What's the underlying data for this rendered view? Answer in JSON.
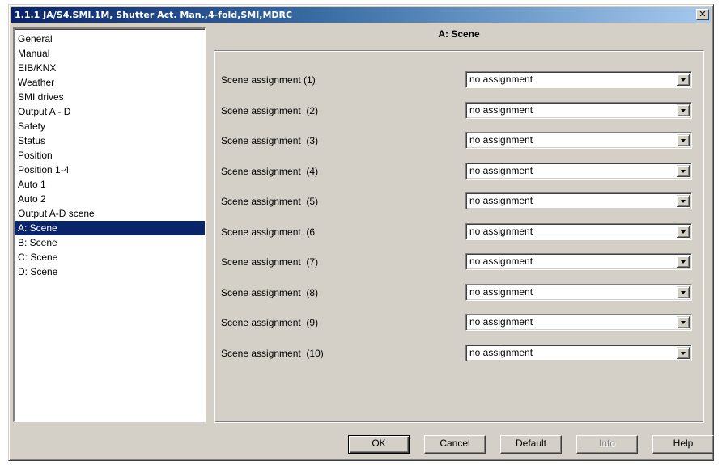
{
  "window": {
    "title": "1.1.1 JA/S4.SMI.1M, Shutter Act. Man.,4-fold,SMI,MDRC",
    "close_glyph": "✕"
  },
  "nav": {
    "items": [
      "General",
      "Manual",
      "EIB/KNX",
      "Weather",
      "SMI drives",
      "Output A - D",
      "Safety",
      "Status",
      "Position",
      "Position 1-4",
      "Auto 1",
      "Auto 2",
      "Output A-D scene",
      "A: Scene",
      "B: Scene",
      "C: Scene",
      "D: Scene"
    ],
    "selected": "A: Scene"
  },
  "panel": {
    "title": "A: Scene",
    "rows": [
      {
        "label": "Scene assignment (1)",
        "value": "no assignment"
      },
      {
        "label": "Scene assignment  (2)",
        "value": "no assignment"
      },
      {
        "label": "Scene assignment  (3)",
        "value": "no assignment"
      },
      {
        "label": "Scene assignment  (4)",
        "value": "no assignment"
      },
      {
        "label": "Scene assignment  (5)",
        "value": "no assignment"
      },
      {
        "label": "Scene assignment  (6",
        "value": "no assignment"
      },
      {
        "label": "Scene assignment  (7)",
        "value": "no assignment"
      },
      {
        "label": "Scene assignment  (8)",
        "value": "no assignment"
      },
      {
        "label": "Scene assignment  (9)",
        "value": "no assignment"
      },
      {
        "label": "Scene assignment  (10)",
        "value": "no assignment"
      }
    ]
  },
  "buttons": {
    "ok": "OK",
    "cancel": "Cancel",
    "default": "Default",
    "info": "Info",
    "help": "Help"
  },
  "colors": {
    "selection": "#0a246a",
    "face": "#d4d0c8"
  }
}
